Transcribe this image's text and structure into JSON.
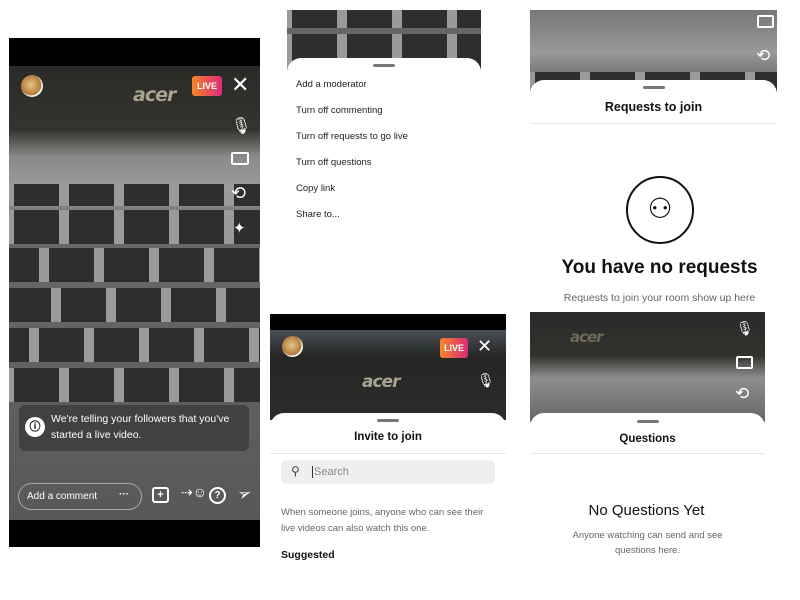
{
  "panel_live": {
    "live_badge": "LIVE",
    "logo_text": "acer",
    "notice": "We're telling your followers that you've started a live video.",
    "comment_placeholder": "Add a comment",
    "more": "···",
    "icons": [
      "close-icon",
      "microphone-icon",
      "video-camera-icon",
      "flip-camera-icon",
      "sparkle-effects-icon",
      "info-icon",
      "add-video-icon",
      "add-guest-icon",
      "question-icon",
      "send-icon"
    ]
  },
  "panel_menu": {
    "items": [
      "Add a moderator",
      "Turn off commenting",
      "Turn off requests to go live",
      "Turn off questions",
      "Copy link",
      "Share to..."
    ]
  },
  "panel_invite": {
    "live_badge": "LIVE",
    "logo_text": "acer",
    "title": "Invite to join",
    "search_placeholder": "Search",
    "info": "When someone joins, anyone who can see their live videos can also watch this one.",
    "suggested": "Suggested"
  },
  "panel_requests": {
    "title": "Requests to join",
    "heading": "You have no requests",
    "subtext": "Requests to join your room show up here"
  },
  "panel_questions": {
    "logo_text": "acer",
    "title": "Questions",
    "heading": "No Questions Yet",
    "subtext": "Anyone watching can send and see questions here."
  },
  "colors": {
    "live_gradient_start": "#f58529",
    "live_gradient_end": "#dd2a7b",
    "search_bg": "#efefef"
  }
}
